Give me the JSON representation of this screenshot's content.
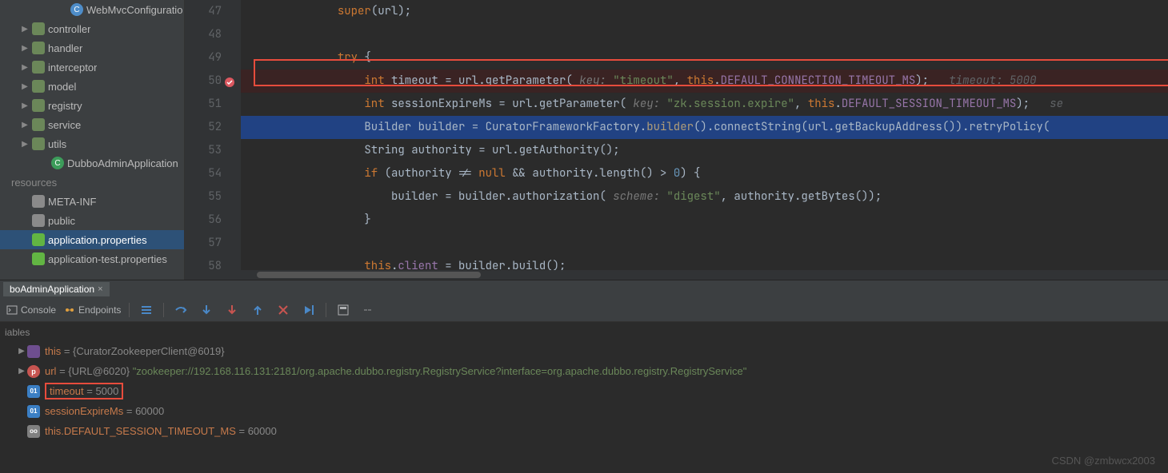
{
  "tree": {
    "items": [
      {
        "indent": 70,
        "arrow": "",
        "icon": "cls",
        "iconText": "C",
        "label": "WebMvcConfiguratio"
      },
      {
        "indent": 22,
        "arrow": "▶",
        "icon": "pkg",
        "iconText": "",
        "label": "controller"
      },
      {
        "indent": 22,
        "arrow": "▶",
        "icon": "pkg",
        "iconText": "",
        "label": "handler"
      },
      {
        "indent": 22,
        "arrow": "▶",
        "icon": "pkg",
        "iconText": "",
        "label": "interceptor"
      },
      {
        "indent": 22,
        "arrow": "▶",
        "icon": "pkg",
        "iconText": "",
        "label": "model"
      },
      {
        "indent": 22,
        "arrow": "▶",
        "icon": "pkg",
        "iconText": "",
        "label": "registry"
      },
      {
        "indent": 22,
        "arrow": "▶",
        "icon": "pkg",
        "iconText": "",
        "label": "service"
      },
      {
        "indent": 22,
        "arrow": "▶",
        "icon": "pkg",
        "iconText": "",
        "label": "utils"
      },
      {
        "indent": 46,
        "arrow": "",
        "icon": "app",
        "iconText": "C",
        "label": "DubboAdminApplication"
      },
      {
        "indent": 0,
        "arrow": "",
        "icon": "",
        "iconText": "",
        "label": "resources",
        "dim": true
      },
      {
        "indent": 22,
        "arrow": "",
        "icon": "dir",
        "iconText": "",
        "label": "META-INF"
      },
      {
        "indent": 22,
        "arrow": "",
        "icon": "dir",
        "iconText": "",
        "label": "public"
      },
      {
        "indent": 22,
        "arrow": "",
        "icon": "prop",
        "iconText": "",
        "label": "application.properties",
        "sel": true
      },
      {
        "indent": 22,
        "arrow": "",
        "icon": "prop",
        "iconText": "",
        "label": "application-test.properties"
      }
    ]
  },
  "code": {
    "start": 47,
    "lines": [
      {
        "n": 47,
        "seg": [
          {
            "c": "",
            "t": "            "
          },
          {
            "c": "kw",
            "t": "super"
          },
          {
            "c": "",
            "t": "(url);"
          }
        ]
      },
      {
        "n": 48,
        "seg": [
          {
            "c": "",
            "t": ""
          }
        ]
      },
      {
        "n": 49,
        "seg": [
          {
            "c": "",
            "t": "            "
          },
          {
            "c": "kw",
            "t": "try"
          },
          {
            "c": "",
            "t": " {"
          }
        ]
      },
      {
        "n": 50,
        "bp": true,
        "seg": [
          {
            "c": "",
            "t": "                "
          },
          {
            "c": "kw",
            "t": "int"
          },
          {
            "c": "",
            "t": " timeout = url.getParameter( "
          },
          {
            "c": "par",
            "t": "key:"
          },
          {
            "c": "",
            "t": " "
          },
          {
            "c": "str",
            "t": "\"timeout\""
          },
          {
            "c": "",
            "t": ", "
          },
          {
            "c": "kw",
            "t": "this"
          },
          {
            "c": "",
            "t": "."
          },
          {
            "c": "fld",
            "t": "DEFAULT_CONNECTION_TIMEOUT_MS"
          },
          {
            "c": "",
            "t": ");   "
          },
          {
            "c": "hint",
            "t": "timeout: 5000"
          }
        ]
      },
      {
        "n": 51,
        "seg": [
          {
            "c": "",
            "t": "                "
          },
          {
            "c": "kw",
            "t": "int"
          },
          {
            "c": "",
            "t": " sessionExpireMs = url.getParameter( "
          },
          {
            "c": "par",
            "t": "key:"
          },
          {
            "c": "",
            "t": " "
          },
          {
            "c": "str",
            "t": "\"zk.session.expire\""
          },
          {
            "c": "",
            "t": ", "
          },
          {
            "c": "kw",
            "t": "this"
          },
          {
            "c": "",
            "t": "."
          },
          {
            "c": "fld",
            "t": "DEFAULT_SESSION_TIMEOUT_MS"
          },
          {
            "c": "",
            "t": ");   "
          },
          {
            "c": "hint",
            "t": "se"
          }
        ]
      },
      {
        "n": 52,
        "cur": true,
        "seg": [
          {
            "c": "",
            "t": "                Builder builder = CuratorFrameworkFactory."
          },
          {
            "c": "call",
            "t": "builder"
          },
          {
            "c": "",
            "t": "().connectString(url.getBackupAddress()).retryPolicy("
          }
        ]
      },
      {
        "n": 53,
        "seg": [
          {
            "c": "",
            "t": "                String authority = url.getAuthority();"
          }
        ]
      },
      {
        "n": 54,
        "seg": [
          {
            "c": "",
            "t": "                "
          },
          {
            "c": "kw",
            "t": "if"
          },
          {
            "c": "",
            "t": " (authority != "
          },
          {
            "c": "kw",
            "t": "null"
          },
          {
            "c": "",
            "t": " && authority.length() > "
          },
          {
            "c": "num",
            "t": "0"
          },
          {
            "c": "",
            "t": ") {"
          }
        ]
      },
      {
        "n": 55,
        "seg": [
          {
            "c": "",
            "t": "                    builder = builder.authorization( "
          },
          {
            "c": "par",
            "t": "scheme:"
          },
          {
            "c": "",
            "t": " "
          },
          {
            "c": "str",
            "t": "\"digest\""
          },
          {
            "c": "",
            "t": ", authority.getBytes());"
          }
        ]
      },
      {
        "n": 56,
        "seg": [
          {
            "c": "",
            "t": "                }"
          }
        ]
      },
      {
        "n": 57,
        "seg": [
          {
            "c": "",
            "t": ""
          }
        ]
      },
      {
        "n": 58,
        "seg": [
          {
            "c": "",
            "t": "                "
          },
          {
            "c": "kw",
            "t": "this"
          },
          {
            "c": "",
            "t": "."
          },
          {
            "c": "fld",
            "t": "client"
          },
          {
            "c": "",
            "t": " = builder.build();"
          }
        ]
      }
    ]
  },
  "debug": {
    "runTab": "boAdminApplication",
    "toolbar": {
      "console": "Console",
      "endpoints": "Endpoints"
    },
    "varsHeader": "iables",
    "vars": [
      {
        "arrow": "▶",
        "ico": "obj",
        "icoText": "",
        "name": "this",
        "sep": " = ",
        "val": "{CuratorZookeeperClient@6019}"
      },
      {
        "arrow": "▶",
        "ico": "p",
        "icoText": "p",
        "name": "url",
        "sep": " = ",
        "val": "{URL@6020} ",
        "str": "\"zookeeper://192.168.116.131:2181/org.apache.dubbo.registry.RegistryService?interface=org.apache.dubbo.registry.RegistryService\""
      },
      {
        "arrow": "",
        "ico": "i01",
        "icoText": "01",
        "name": "timeout",
        "sep": " = ",
        "val": "5000",
        "box": true
      },
      {
        "arrow": "",
        "ico": "i01",
        "icoText": "01",
        "name": "sessionExpireMs",
        "sep": " = ",
        "val": "60000"
      },
      {
        "arrow": "",
        "ico": "oo",
        "icoText": "oo",
        "name": "this.DEFAULT_SESSION_TIMEOUT_MS",
        "sep": " = ",
        "val": "60000"
      }
    ]
  },
  "watermark": "CSDN @zmbwcx2003"
}
